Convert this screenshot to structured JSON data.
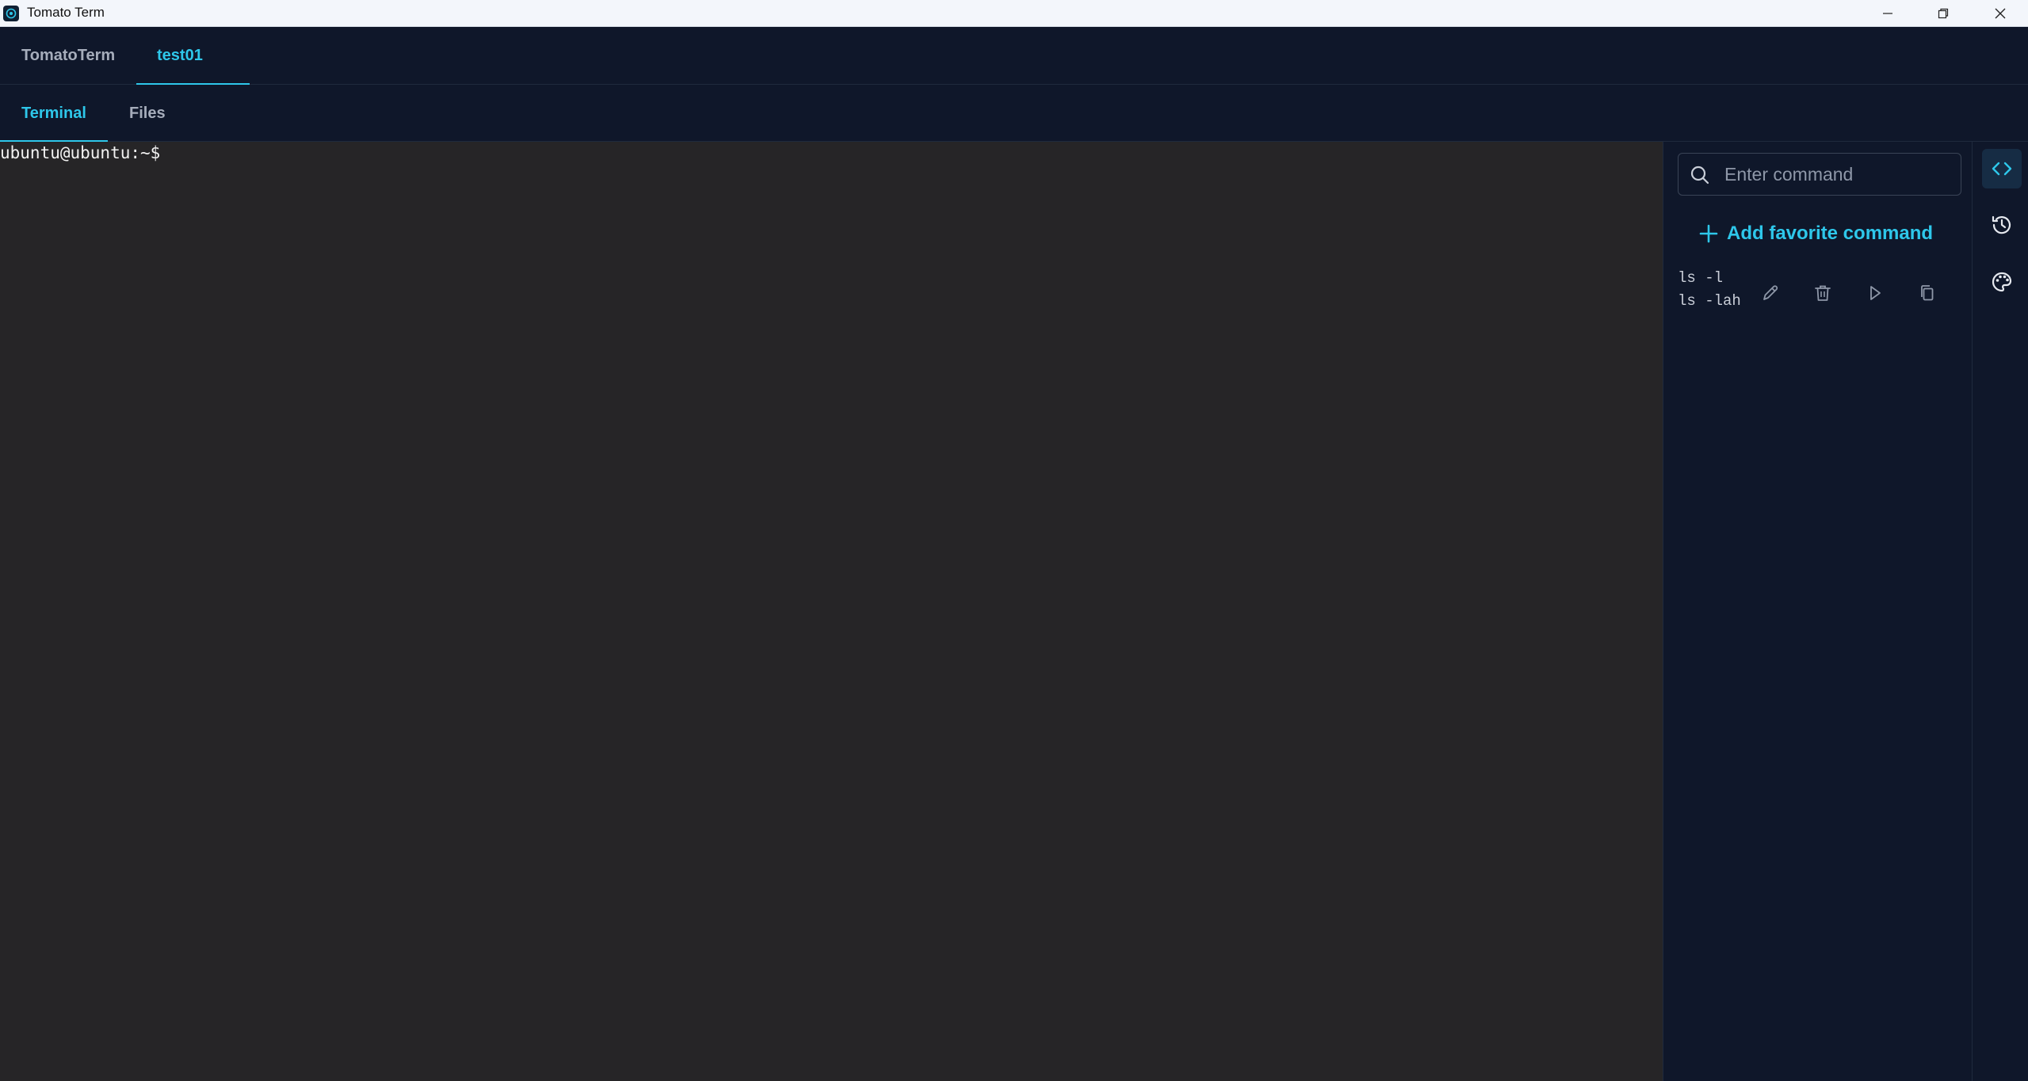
{
  "window": {
    "title": "Tomato Term",
    "icons": [
      "app-icon",
      "minimize-icon",
      "restore-icon",
      "close-icon"
    ]
  },
  "top_tabs": [
    {
      "label": "TomatoTerm",
      "active": false
    },
    {
      "label": "test01",
      "active": true
    }
  ],
  "sub_tabs": [
    {
      "label": "Terminal",
      "active": true
    },
    {
      "label": "Files",
      "active": false
    }
  ],
  "terminal": {
    "prompt": "ubuntu@ubuntu:~$"
  },
  "side_panel": {
    "search": {
      "placeholder": "Enter command",
      "value": ""
    },
    "add_favorite_label": "Add favorite command",
    "favorites": [
      {
        "lines": [
          "ls -l",
          "ls -lah"
        ],
        "actions": [
          "edit-icon",
          "delete-icon",
          "run-icon",
          "copy-icon"
        ]
      }
    ]
  },
  "rail": {
    "items": [
      {
        "icon": "code-icon",
        "active": true
      },
      {
        "icon": "history-icon",
        "active": false
      },
      {
        "icon": "palette-icon",
        "active": false
      }
    ]
  },
  "colors": {
    "accent": "#2ec7ea",
    "background": "#0f172a",
    "terminal_bg": "#262527"
  }
}
